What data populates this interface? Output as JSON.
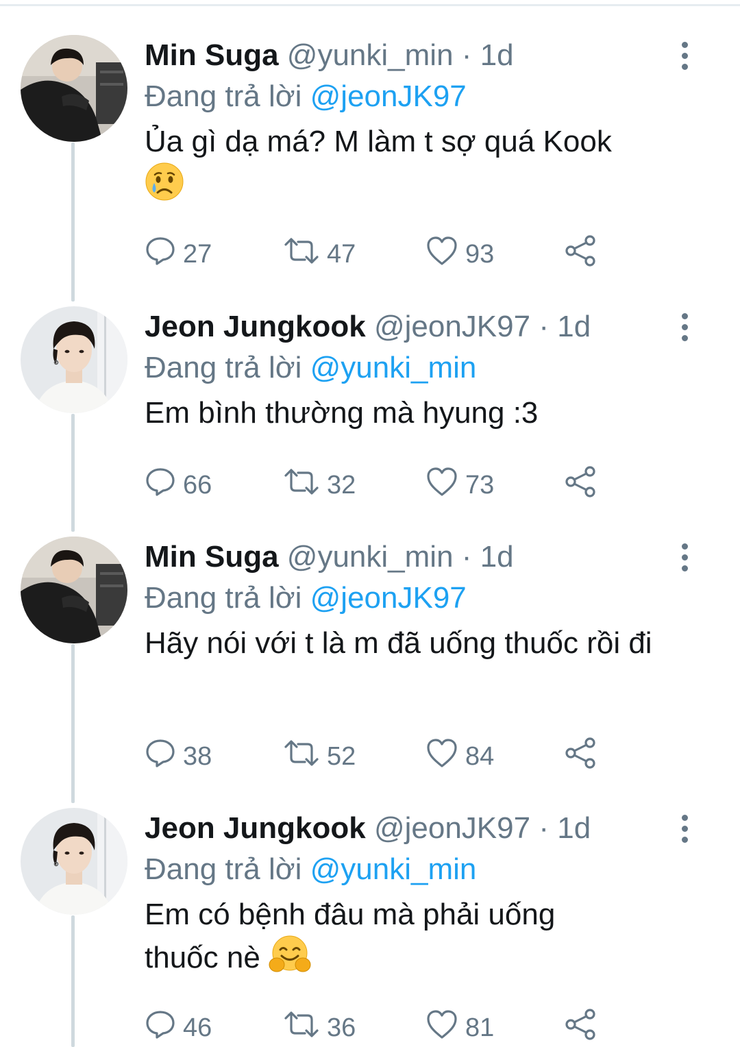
{
  "reply_prefix": "Đang trả lời",
  "colors": {
    "accent": "#1da1f2",
    "muted": "#657786",
    "text": "#14171a",
    "line": "#cfd9de"
  },
  "tweets": [
    {
      "name": "Min Suga",
      "handle": "@yunki_min",
      "dot": "·",
      "time": "1d",
      "reply_to": "@jeonJK97",
      "text": "Ủa gì dạ má? M làm t sợ quá Kook",
      "emoji": "crying-face",
      "replies": "27",
      "retweets": "47",
      "likes": "93"
    },
    {
      "name": "Jeon Jungkook",
      "handle": "@jeonJK97",
      "dot": "·",
      "time": "1d",
      "reply_to": "@yunki_min",
      "text": "Em bình thường mà hyung :3",
      "replies": "66",
      "retweets": "32",
      "likes": "73"
    },
    {
      "name": "Min Suga",
      "handle": "@yunki_min",
      "dot": "·",
      "time": "1d",
      "reply_to": "@jeonJK97",
      "text": "Hãy nói với t là m đã uống thuốc rồi đi",
      "replies": "38",
      "retweets": "52",
      "likes": "84"
    },
    {
      "name": "Jeon Jungkook",
      "handle": "@jeonJK97",
      "dot": "·",
      "time": "1d",
      "reply_to": "@yunki_min",
      "text": "Em có bệnh đâu mà phải uống thuốc nè",
      "emoji": "hugging-face",
      "replies": "46",
      "retweets": "36",
      "likes": "81"
    }
  ]
}
